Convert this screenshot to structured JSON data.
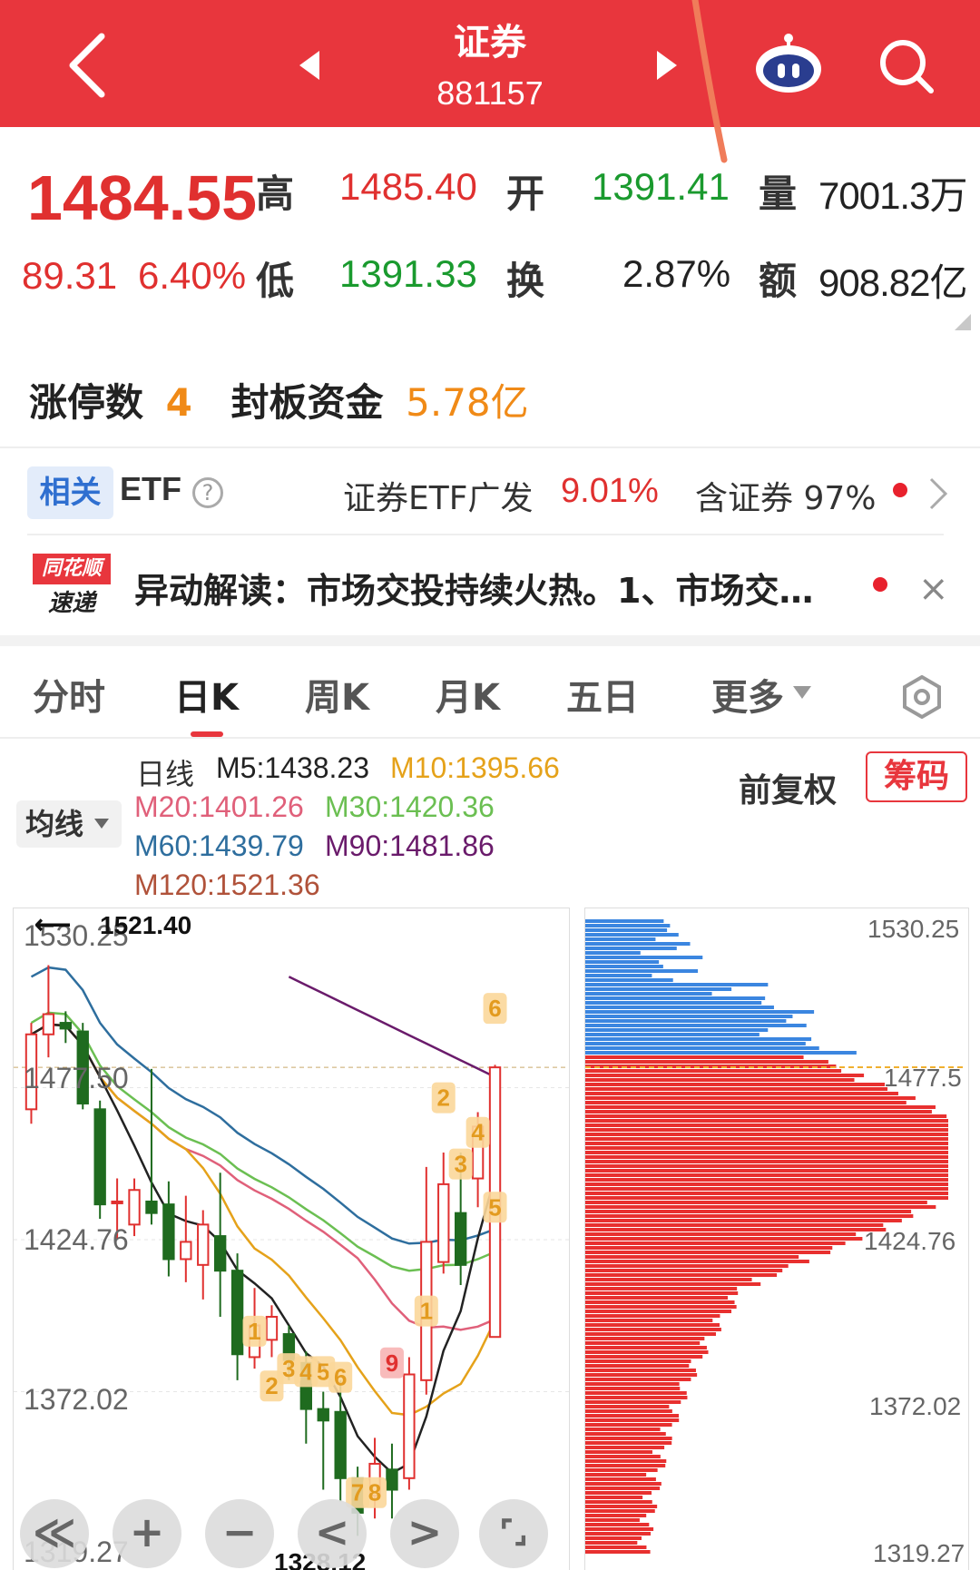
{
  "header": {
    "title": "证券",
    "code": "881157"
  },
  "quote": {
    "price": "1484.55",
    "change": "89.31",
    "change_pct": "6.40%",
    "labels": {
      "high": "高",
      "open": "开",
      "volume": "量",
      "low": "低",
      "turnover": "换",
      "amount": "额"
    },
    "high": "1485.40",
    "open": "1391.41",
    "volume": "7001.3万",
    "low": "1391.33",
    "turnover_rate": "2.87%",
    "amount": "908.82亿"
  },
  "limit": {
    "count_label": "涨停数",
    "count": "4",
    "fund_label": "封板资金",
    "fund": "5.78亿"
  },
  "etf": {
    "tag": "相关",
    "label": "ETF",
    "help": "?",
    "name": "证券ETF广发",
    "pct": "9.01%",
    "holding": "含证券 97%"
  },
  "news": {
    "logo_top": "同花顺",
    "logo_bottom": "速递",
    "text": "异动解读：市场交投持续火热。1、市场交…",
    "close": "×"
  },
  "tabs": [
    "分时",
    "日K",
    "周K",
    "月K",
    "五日",
    "更多"
  ],
  "indicators": {
    "line_label": "日线",
    "m5": "M5:1438.23",
    "m10": "M10:1395.66",
    "m20": "M20:1401.26",
    "m30": "M30:1420.36",
    "m60": "M60:1439.79",
    "m90": "M90:1481.86",
    "m120": "M120:1521.36",
    "ma_button": "均线",
    "adjust": "前复权",
    "chips": "筹码"
  },
  "colors": {
    "m5": "#222222",
    "m10": "#e5a21a",
    "m20": "#e0607a",
    "m30": "#6bbf52",
    "m60": "#2e6e9e",
    "m90": "#6a1b6b",
    "m120": "#b0523a",
    "up": "#e0302f",
    "down": "#1f6b1f",
    "accent": "#e8363d"
  },
  "chart_data": {
    "type": "candlestick",
    "y_ticks": [
      "1530.25",
      "1477.50",
      "1424.76",
      "1372.02",
      "1319.27"
    ],
    "chip_ticks": [
      "1530.25",
      "1477.5",
      "1424.76",
      "1372.02",
      "1319.27"
    ],
    "high_label": "1521.40",
    "low_label": "1328.12",
    "ylim": [
      1319.27,
      1530.25
    ],
    "candles": [
      {
        "o": 1470,
        "c": 1496,
        "h": 1500,
        "l": 1465
      },
      {
        "o": 1496,
        "c": 1503,
        "h": 1520,
        "l": 1488
      },
      {
        "o": 1500,
        "c": 1498,
        "h": 1504,
        "l": 1493
      },
      {
        "o": 1497,
        "c": 1472,
        "h": 1500,
        "l": 1470
      },
      {
        "o": 1470,
        "c": 1437,
        "h": 1473,
        "l": 1432
      },
      {
        "o": 1438,
        "c": 1438,
        "h": 1446,
        "l": 1425
      },
      {
        "o": 1430,
        "c": 1442,
        "h": 1446,
        "l": 1426
      },
      {
        "o": 1438,
        "c": 1434,
        "h": 1484,
        "l": 1430
      },
      {
        "o": 1437,
        "c": 1418,
        "h": 1445,
        "l": 1412
      },
      {
        "o": 1418,
        "c": 1424,
        "h": 1440,
        "l": 1410
      },
      {
        "o": 1416,
        "c": 1430,
        "h": 1435,
        "l": 1404
      },
      {
        "o": 1426,
        "c": 1414,
        "h": 1448,
        "l": 1398
      },
      {
        "o": 1414,
        "c": 1385,
        "h": 1420,
        "l": 1376
      },
      {
        "o": 1384,
        "c": 1395,
        "h": 1408,
        "l": 1380
      },
      {
        "o": 1390,
        "c": 1398,
        "h": 1402,
        "l": 1384
      },
      {
        "o": 1392,
        "c": 1383,
        "h": 1395,
        "l": 1376
      },
      {
        "o": 1382,
        "c": 1366,
        "h": 1386,
        "l": 1354
      },
      {
        "o": 1366,
        "c": 1362,
        "h": 1372,
        "l": 1338
      },
      {
        "o": 1365,
        "c": 1342,
        "h": 1376,
        "l": 1334
      },
      {
        "o": 1342,
        "c": 1330,
        "h": 1346,
        "l": 1322
      },
      {
        "o": 1336,
        "c": 1347,
        "h": 1356,
        "l": 1328
      },
      {
        "o": 1345,
        "c": 1338,
        "h": 1354,
        "l": 1328
      },
      {
        "o": 1342,
        "c": 1378,
        "h": 1384,
        "l": 1338
      },
      {
        "o": 1376,
        "c": 1424,
        "h": 1450,
        "l": 1371
      },
      {
        "o": 1417,
        "c": 1444,
        "h": 1455,
        "l": 1413
      },
      {
        "o": 1434,
        "c": 1416,
        "h": 1455,
        "l": 1409
      },
      {
        "o": 1446,
        "c": 1464,
        "h": 1469,
        "l": 1436
      },
      {
        "o": 1391,
        "c": 1484.55,
        "h": 1485.4,
        "l": 1391.33
      }
    ],
    "markers": [
      {
        "i": 13,
        "p": 1393,
        "t": "1"
      },
      {
        "i": 14,
        "p": 1374,
        "t": "2"
      },
      {
        "i": 15,
        "p": 1380,
        "t": "3"
      },
      {
        "i": 16,
        "p": 1379,
        "t": "4"
      },
      {
        "i": 17,
        "p": 1379,
        "t": "5"
      },
      {
        "i": 18,
        "p": 1377,
        "t": "6"
      },
      {
        "i": 19,
        "p": 1337,
        "t": "7"
      },
      {
        "i": 20,
        "p": 1337,
        "t": "8"
      },
      {
        "i": 21,
        "p": 1382,
        "t": "9"
      },
      {
        "i": 23,
        "p": 1400,
        "t": "1"
      },
      {
        "i": 24,
        "p": 1474,
        "t": "2"
      },
      {
        "i": 25,
        "p": 1451,
        "t": "3"
      },
      {
        "i": 26,
        "p": 1462,
        "t": "4"
      },
      {
        "i": 27,
        "p": 1436,
        "t": "5"
      },
      {
        "i": 27,
        "p": 1505,
        "t": "6"
      }
    ]
  },
  "controls": [
    "≪",
    "+",
    "−",
    "<",
    ">",
    "⌜⌟"
  ]
}
